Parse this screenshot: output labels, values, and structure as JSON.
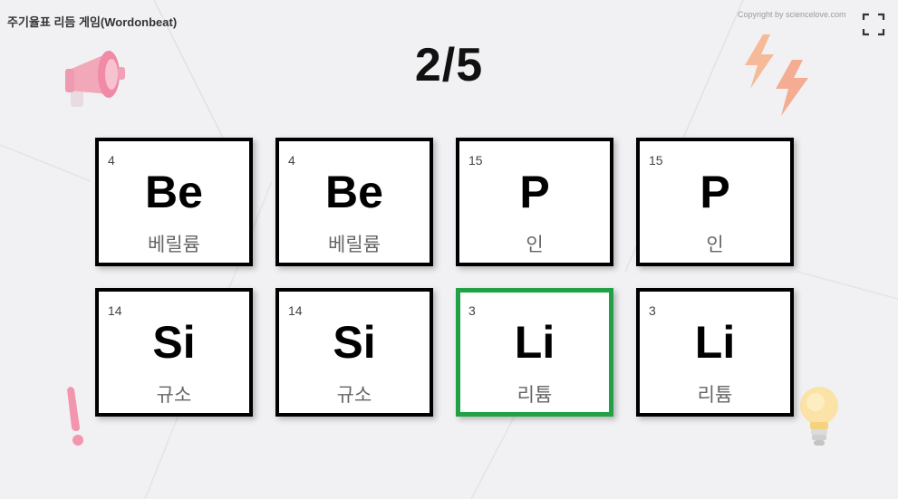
{
  "header": {
    "title": "주기율표 리듬 게임(Wordonbeat)",
    "copyright": "Copyright by sciencelove.com",
    "fullscreen_icon": "fullscreen-icon"
  },
  "game": {
    "progress": "2/5",
    "cards": [
      {
        "number": "4",
        "symbol": "Be",
        "name": "베릴륨",
        "selected": false
      },
      {
        "number": "4",
        "symbol": "Be",
        "name": "베릴륨",
        "selected": false
      },
      {
        "number": "15",
        "symbol": "P",
        "name": "인",
        "selected": false
      },
      {
        "number": "15",
        "symbol": "P",
        "name": "인",
        "selected": false
      },
      {
        "number": "14",
        "symbol": "Si",
        "name": "규소",
        "selected": false
      },
      {
        "number": "14",
        "symbol": "Si",
        "name": "규소",
        "selected": false
      },
      {
        "number": "3",
        "symbol": "Li",
        "name": "리튬",
        "selected": true
      },
      {
        "number": "3",
        "symbol": "Li",
        "name": "리튬",
        "selected": false
      }
    ]
  },
  "colors": {
    "background": "#f1f1f4",
    "card_border": "#000000",
    "selected_border": "#22a045"
  },
  "decorations": [
    "megaphone-icon",
    "lightning-icon",
    "exclamation-icon",
    "lightbulb-icon"
  ]
}
